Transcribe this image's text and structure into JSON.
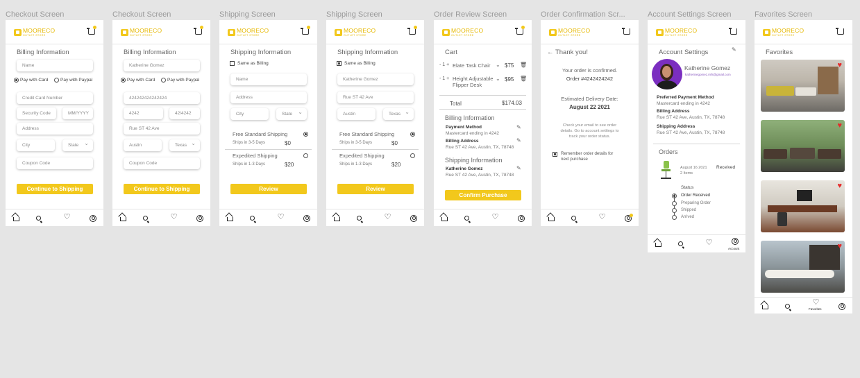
{
  "brand": {
    "name": "MOORECO",
    "sub": "OUTLET STORE",
    "accent": "#f2c81c"
  },
  "nav_icons": [
    "home-icon",
    "search-icon",
    "heart-icon",
    "user-icon"
  ],
  "screens": {
    "checkout1": {
      "title": "Checkout Screen",
      "section": "Billing Information",
      "name": "Name",
      "pay_card": "Pay with Card",
      "pay_paypal": "Pay with Paypal",
      "card": "Credit Card Number",
      "cvc": "Security Code",
      "exp": "MM/YYYY",
      "address": "Address",
      "city": "City",
      "state": "State",
      "coupon": "Coupon Code",
      "button": "Continue to Shipping"
    },
    "checkout2": {
      "title": "Checkout Screen",
      "section": "Billing Information",
      "name": "Katherine Gomez",
      "pay_card": "Pay with Card",
      "pay_paypal": "Pay with Paypal",
      "card": "424242424242424",
      "cvc": "4242",
      "exp": "42/4242",
      "address": "Rue ST 42 Ave",
      "city": "Austin",
      "state": "Texas",
      "coupon": "Coupon Code",
      "button": "Continue to Shipping"
    },
    "shipping1": {
      "title": "Shipping Screen",
      "section": "Shipping Information",
      "same": "Same as Billing",
      "name": "Name",
      "address": "Address",
      "city": "City",
      "state": "State",
      "free": "Free Standard Shipping",
      "free_days": "Ships in 3-5 Days",
      "free_price": "$0",
      "exp": "Expedited Shipping",
      "exp_days": "Ships in 1-3 Days",
      "exp_price": "$20",
      "button": "Review"
    },
    "shipping2": {
      "title": "Shipping Screen",
      "section": "Shipping Information",
      "same": "Same as Billing",
      "name": "Katherine Gomez",
      "address": "Rue ST 42 Ave",
      "city": "Austin",
      "state": "Texas",
      "free": "Free Standard Shipping",
      "free_days": "Ships in 3-5 Days",
      "free_price": "$0",
      "exp": "Expedited Shipping",
      "exp_days": "Ships in 1-3 Days",
      "exp_price": "$20",
      "button": "Review"
    },
    "review": {
      "title": "Order Review Screen",
      "cart": "Cart",
      "items": [
        {
          "qty": "- 1 +",
          "name": "Elate Task Chair",
          "price": "$75"
        },
        {
          "qty": "- 1 +",
          "name": "Height Adjustable Flipper Desk",
          "price": "$95"
        }
      ],
      "total_label": "Total",
      "total": "$174.03",
      "billing": "Billing Information",
      "pm_label": "Payment Method",
      "pm_value": "Mastercard ending in 4242",
      "ba_label": "Billing Address",
      "ba_value": "Rue ST 42 Ave, Austin, TX, 78748",
      "shipping": "Shipping Information",
      "ship_name": "Katherine Gomez",
      "ship_addr": "Rue ST 42 Ave, Austin, TX, 78748",
      "button": "Confirm Purchase"
    },
    "confirm": {
      "title": "Order Confirmation Scr...",
      "back": "← Thank you!",
      "line1": "Your order is confirmed.",
      "line2": "Order #4242424242",
      "est": "Estimated Delivery Date:",
      "date": "August 22 2021",
      "note1": "Check your email to see order",
      "note2": "details. Go to account settings to",
      "note3": "track your order status.",
      "remember1": "Remember order details for",
      "remember2": "next purchase"
    },
    "account": {
      "title": "Account Settings Screen",
      "section": "Account Settings",
      "user": "Katherine Gomez",
      "email": "katherinegomez.mfs@gmail.com",
      "pm_label": "Preferred Payment Method",
      "pm_value": "Mastercard ending in 4242",
      "ba_label": "Billing Address",
      "ba_value": "Rue ST 42 Ave, Austin, TX, 78748",
      "sa_label": "Shipping Address",
      "sa_value": "Rue ST 42 Ave, Austin, TX, 78748",
      "orders": "Orders",
      "order_date": "August 16 2021",
      "order_items": "2 Items",
      "order_state": "Received",
      "status_label": "Status",
      "steps": [
        "Order Received",
        "Preparing Order",
        "Shipped",
        "Arrived"
      ],
      "nav_label": "Account"
    },
    "favorites": {
      "title": "Favorites Screen",
      "section": "Favorites",
      "nav_label": "Favorites"
    }
  }
}
